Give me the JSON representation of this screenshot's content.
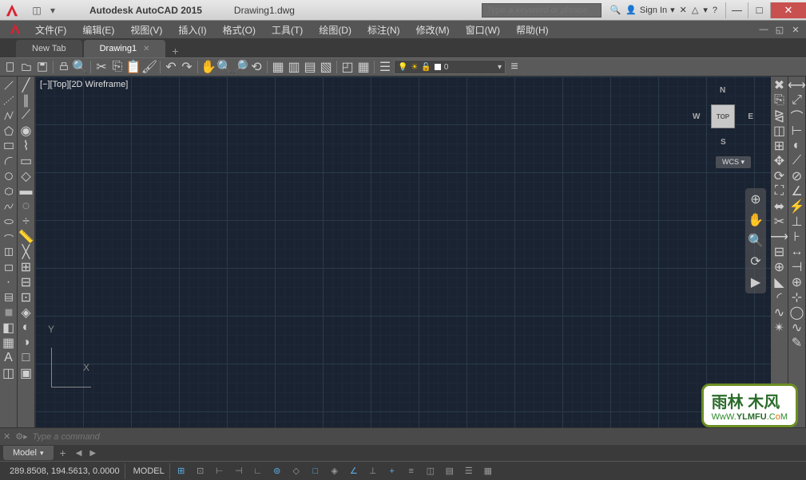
{
  "titlebar": {
    "app_name": "Autodesk AutoCAD 2015",
    "document": "Drawing1.dwg",
    "search_placeholder": "Type a keyword or phrase",
    "sign_in": "Sign In"
  },
  "menubar": {
    "items": [
      {
        "label": "文件(F)"
      },
      {
        "label": "编辑(E)"
      },
      {
        "label": "视图(V)"
      },
      {
        "label": "插入(I)"
      },
      {
        "label": "格式(O)"
      },
      {
        "label": "工具(T)"
      },
      {
        "label": "绘图(D)"
      },
      {
        "label": "标注(N)"
      },
      {
        "label": "修改(M)"
      },
      {
        "label": "窗口(W)"
      },
      {
        "label": "帮助(H)"
      }
    ]
  },
  "tabs": {
    "items": [
      {
        "label": "New Tab",
        "active": false
      },
      {
        "label": "Drawing1",
        "active": true
      }
    ]
  },
  "layer": {
    "current": "0"
  },
  "viewport": {
    "label": "[−][Top][2D Wireframe]"
  },
  "viewcube": {
    "face": "TOP",
    "n": "N",
    "s": "S",
    "e": "E",
    "w": "W",
    "wcs": "WCS"
  },
  "ucs": {
    "x": "X",
    "y": "Y"
  },
  "commandline": {
    "placeholder": "Type a command"
  },
  "layout_tabs": {
    "items": [
      {
        "label": "Model"
      }
    ]
  },
  "statusbar": {
    "coords": "289.8508, 194.5613, 0.0000",
    "space": "MODEL"
  },
  "watermark": {
    "text": "雨林 木风",
    "url_pre": "WwW.",
    "url_mid": "YLMFU",
    "url_suf1": ".C",
    "url_o": "o",
    "url_suf2": "M"
  }
}
